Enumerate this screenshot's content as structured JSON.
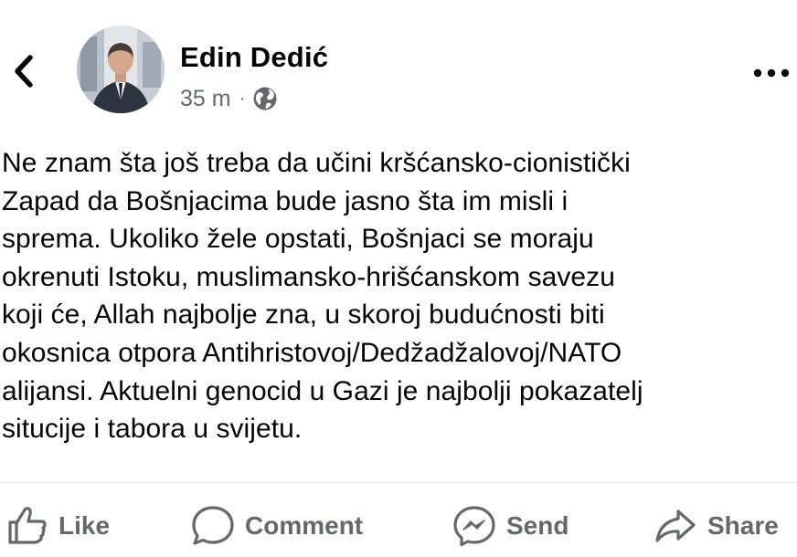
{
  "header": {
    "back_icon": "chevron-left-icon",
    "author_name": "Edin Dedić",
    "timestamp": "35 m",
    "separator": "·",
    "audience_icon": "globe-icon",
    "more_icon": "more-horizontal-icon"
  },
  "post": {
    "text": "Ne znam šta još treba da učini kršćansko-cionistički\nZapad da Bošnjacima bude jasno šta im misli i\nsprema. Ukoliko žele opstati, Bošnjaci se moraju\nokrenuti Istoku, muslimansko-hrišćanskom savezu\nkoji će, Allah najbolje zna, u skoroj budućnosti biti\nokosnica otpora Antihristovoj/Dedžadžalovoj/NATO\nalijansi. Aktuelni genocid u Gazi je najbolji pokazatelj\nsitucije i tabora u svijetu."
  },
  "actions": {
    "like_label": "Like",
    "comment_label": "Comment",
    "send_label": "Send",
    "share_label": "Share"
  },
  "colors": {
    "text": "#050505",
    "secondary_text": "#65676b",
    "divider": "#e4e6eb"
  }
}
